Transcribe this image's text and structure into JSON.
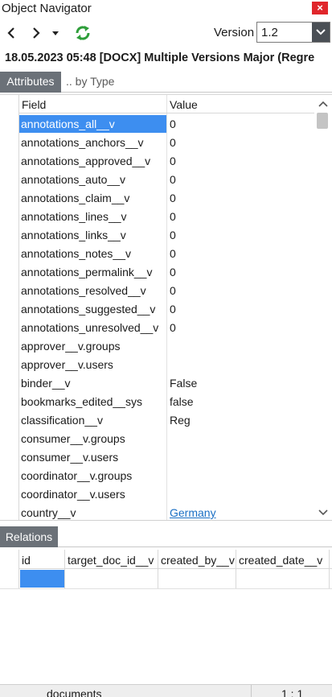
{
  "window": {
    "title": "Object Navigator",
    "close_label": "×"
  },
  "toolbar": {
    "version_label": "Version",
    "version_value": "1.2"
  },
  "document_title": "18.05.2023 05:48 [DOCX] Multiple Versions Major (Regre",
  "tabs": {
    "attributes": "Attributes",
    "by_type": ".. by Type"
  },
  "attributes_grid": {
    "headers": {
      "field": "Field",
      "value": "Value"
    },
    "rows": [
      {
        "field": "annotations_all__v",
        "value": "0"
      },
      {
        "field": "annotations_anchors__v",
        "value": "0"
      },
      {
        "field": "annotations_approved__v",
        "value": "0"
      },
      {
        "field": "annotations_auto__v",
        "value": "0"
      },
      {
        "field": "annotations_claim__v",
        "value": "0"
      },
      {
        "field": "annotations_lines__v",
        "value": "0"
      },
      {
        "field": "annotations_links__v",
        "value": "0"
      },
      {
        "field": "annotations_notes__v",
        "value": "0"
      },
      {
        "field": "annotations_permalink__v",
        "value": "0"
      },
      {
        "field": "annotations_resolved__v",
        "value": "0"
      },
      {
        "field": "annotations_suggested__v",
        "value": "0"
      },
      {
        "field": "annotations_unresolved__v",
        "value": "0"
      },
      {
        "field": "approver__v.groups",
        "value": ""
      },
      {
        "field": "approver__v.users",
        "value": ""
      },
      {
        "field": "binder__v",
        "value": "False"
      },
      {
        "field": "bookmarks_edited__sys",
        "value": "false"
      },
      {
        "field": "classification__v",
        "value": "Reg"
      },
      {
        "field": "consumer__v.groups",
        "value": ""
      },
      {
        "field": "consumer__v.users",
        "value": ""
      },
      {
        "field": "coordinator__v.groups",
        "value": ""
      },
      {
        "field": "coordinator__v.users",
        "value": ""
      },
      {
        "field": "country__v",
        "value": "Germany"
      }
    ]
  },
  "relations": {
    "tab_label": "Relations",
    "headers": {
      "id": "id",
      "target_doc_id": "target_doc_id__v",
      "created_by": "created_by__v",
      "created_date": "created_date__v"
    }
  },
  "statusbar": {
    "left": "documents",
    "right": "1 : 1"
  },
  "colors": {
    "selection": "#3d8ef0",
    "tab_active": "#6b7178",
    "refresh": "#2e9e3a",
    "link": "#1a6fc4",
    "close": "#e0262b"
  }
}
